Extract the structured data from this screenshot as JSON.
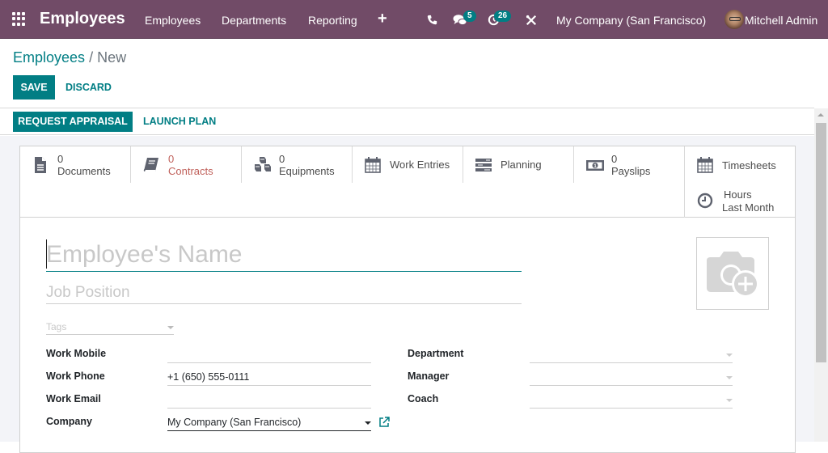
{
  "navbar": {
    "app_title": "Employees",
    "menu": [
      "Employees",
      "Departments",
      "Reporting"
    ],
    "icons": {
      "apps": "apps-grid-icon",
      "new": "plus-icon",
      "phone": "phone-icon",
      "messages": "chat-icon",
      "activities": "clock-icon",
      "debug": "tools-icon"
    },
    "messages_count": "5",
    "activities_count": "26",
    "company": "My Company (San Francisco)",
    "user": "Mitchell Admin",
    "color": "#714b67"
  },
  "breadcrumb": {
    "parent": "Employees",
    "separator": "/",
    "current": "New"
  },
  "control_panel": {
    "save_label": "SAVE",
    "discard_label": "DISCARD"
  },
  "statusbar": {
    "request_appraisal_label": "REQUEST APPRAISAL",
    "launch_plan_label": "LAUNCH PLAN"
  },
  "smart_buttons": [
    {
      "value": "0",
      "label": "Documents",
      "icon": "document-icon"
    },
    {
      "value": "0",
      "label": "Contracts",
      "icon": "book-icon",
      "color": "#c0605a"
    },
    {
      "value": "0",
      "label": "Equipments",
      "icon": "cubes-icon"
    },
    {
      "value": "",
      "label": "Work Entries",
      "icon": "calendar-icon"
    },
    {
      "value": "",
      "label": "Planning",
      "icon": "tasks-icon"
    },
    {
      "value": "0",
      "label": "Payslips",
      "icon": "money-icon"
    },
    {
      "value": "",
      "label": "Timesheets",
      "icon": "calendar-icon"
    },
    {
      "value": "Hours",
      "label": "Last Month",
      "icon": "clock-icon"
    }
  ],
  "form": {
    "name_placeholder": "Employee's Name",
    "job_placeholder": "Job Position",
    "tags_placeholder": "Tags",
    "photo_icon": "camera-add-icon",
    "left_fields": [
      {
        "label": "Work Mobile",
        "value": ""
      },
      {
        "label": "Work Phone",
        "value": "+1 (650) 555-0111"
      },
      {
        "label": "Work Email",
        "value": ""
      },
      {
        "label": "Company",
        "value": "My Company (San Francisco)"
      }
    ],
    "right_fields": [
      {
        "label": "Department",
        "value": ""
      },
      {
        "label": "Manager",
        "value": ""
      },
      {
        "label": "Coach",
        "value": ""
      }
    ]
  },
  "accent_color": "#017e84"
}
